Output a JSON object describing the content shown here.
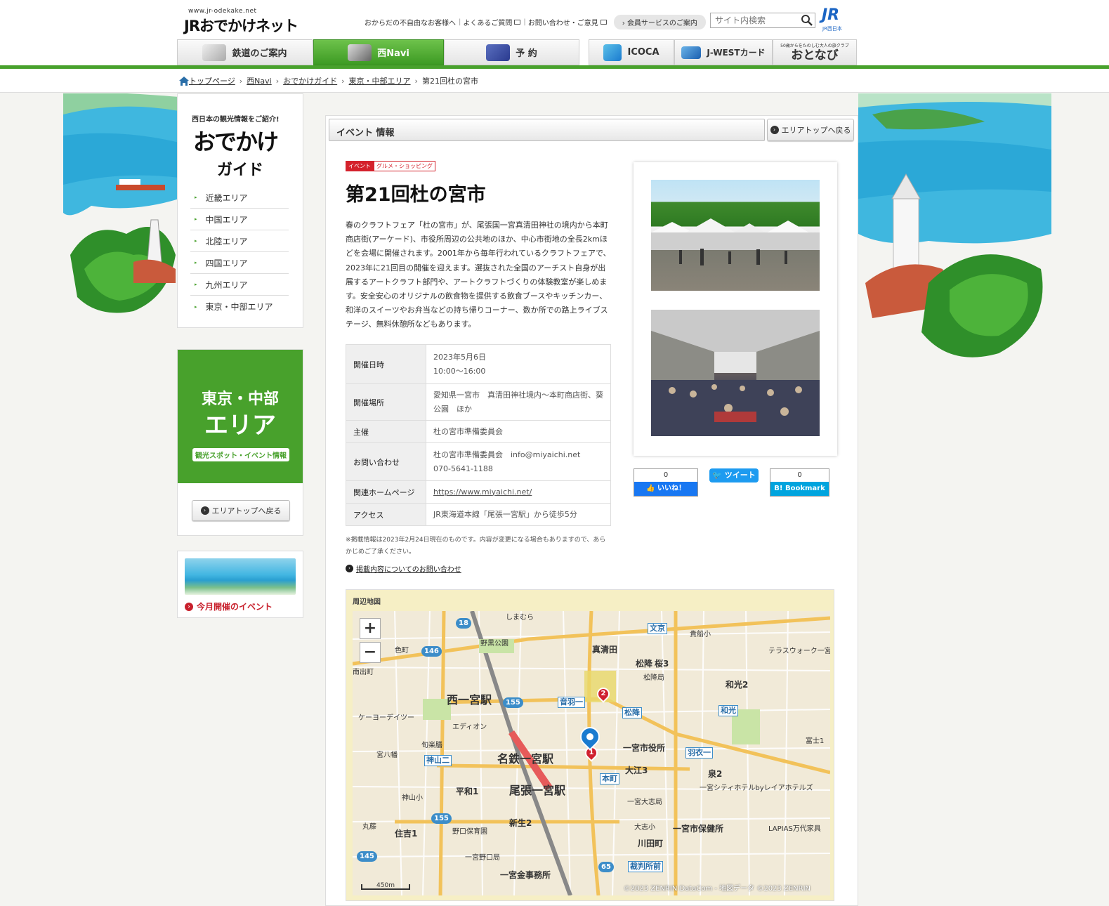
{
  "header": {
    "logo_url_text": "www.jr-odekake.net",
    "logo_text": "JRおでかけネット",
    "util_links": [
      "おからだの不自由なお客様へ",
      "よくあるご質問",
      "お問い合わせ・ご意見"
    ],
    "member_label": "会員サービスのご案内",
    "search_placeholder": "サイト内検索",
    "jr_logo": "JR",
    "jr_logo_sub": "JR西日本"
  },
  "nav": {
    "tabs": [
      {
        "label": "鉄道のご案内",
        "icon": "train-icon"
      },
      {
        "label": "西Navi",
        "icon": "camera-icon"
      },
      {
        "label": "予 約",
        "icon": "seat-icon"
      },
      {
        "label": "ICOCA",
        "icon": "icoca-icon"
      },
      {
        "label": "J-WESTカード",
        "icon": "card-icon"
      },
      {
        "label": "おとなび",
        "icon": "otonavi-logo",
        "sublabel": "50歳からをたのしむ大人の旅クラブ"
      }
    ]
  },
  "breadcrumb": [
    "トップページ",
    "西Navi",
    "おでかけガイド",
    "東京・中部エリア",
    "第21回杜の宮市"
  ],
  "sidebar": {
    "guide_tagline": "西日本の観光情報をご紹介!",
    "guide_title_line1": "おでかけ",
    "guide_title_line2": "ガイド",
    "areas": [
      "近畿エリア",
      "中国エリア",
      "北陸エリア",
      "四国エリア",
      "九州エリア",
      "東京・中部エリア"
    ],
    "area_banner_line1": "東京・中部",
    "area_banner_line2": "エリア",
    "area_banner_sub": "観光スポット・イベント情報",
    "area_top_button": "エリアトップへ戻る",
    "month_event_label": "今月開催のイベント"
  },
  "main": {
    "section_title": "イベント 情報",
    "area_top_button": "エリアトップへ戻る",
    "tags": [
      "イベント",
      "グルメ・ショッピング"
    ],
    "event_title": "第21回杜の宮市",
    "description": "春のクラフトフェア「杜の宮市」が、尾張国一宮真清田神社の境内から本町商店街(アーケード)、市役所周辺の公共地のほか、中心市街地の全長2kmほどを会場に開催されます。2001年から毎年行われているクラフトフェアで、2023年に21回目の開催を迎えます。選抜された全国のアーチスト自身が出展するアートクラフト部門や、アートクラフトづくりの体験教室が楽しめます。安全安心のオリジナルの飲食物を提供する飲食ブースやキッチンカー、和洋のスイーツやお弁当などの持ち帰りコーナー、数か所での路上ライブステージ、無料休憩所などもあります。",
    "info_rows": [
      {
        "label": "開催日時",
        "value": "2023年5月6日\n10:00～16:00"
      },
      {
        "label": "開催場所",
        "value": "愛知県一宮市　真清田神社境内～本町商店街、葵公園　ほか"
      },
      {
        "label": "主催",
        "value": "杜の宮市準備委員会"
      },
      {
        "label": "お問い合わせ",
        "value": "杜の宮市準備委員会　info@miyaichi.net　070-5641-1188"
      },
      {
        "label": "関連ホームページ",
        "value": "https://www.miyaichi.net/"
      },
      {
        "label": "アクセス",
        "value": "JR東海道本線「尾張一宮駅」から徒歩5分"
      }
    ],
    "note": "※掲載情報は2023年2月24日現在のものです。内容が変更になる場合もありますので、あらかじめご了承ください。",
    "inquiry_link": "掲載内容についてのお問い合わせ",
    "sns": {
      "fb_count": "0",
      "fb_label": "いいね！",
      "tw_label": "ツイート",
      "hb_count": "0",
      "hb_label": "Bookmark"
    },
    "map": {
      "label": "周辺地図",
      "zoom_in": "+",
      "zoom_out": "−",
      "scale": "450m",
      "copyright": "©2023 ZENRIN DataCom - 地図データ ©2023 ZENRIN",
      "places": [
        "西一宮駅",
        "名鉄一宮駅",
        "尾張一宮駅",
        "真清田",
        "松降",
        "和光2",
        "一宮市役所",
        "大江3",
        "泉2",
        "一宮市保健所",
        "平和1",
        "神山小",
        "新生2",
        "住吉1",
        "川田町",
        "一宮金事務所",
        "桜3",
        "松降局",
        "LAPIAS万代家具",
        "テラスウォーク一宮",
        "一宮シティホテルbyレイアホテルズ",
        "しまむら",
        "ケーヨーデイツー",
        "エディオン",
        "野黒公園",
        "貴船小",
        "富士1",
        "南出町",
        "色町",
        "一宮大志局",
        "大志小",
        "野口保育園",
        "一宮野口局",
        "丸藤",
        "宮八幡",
        "旬楽膳"
      ],
      "boxes": [
        "文京",
        "音羽一",
        "松降",
        "和光",
        "羽衣一",
        "本町",
        "神山二",
        "裁判所前"
      ],
      "routes": [
        "18",
        "146",
        "155",
        "155",
        "145",
        "65"
      ]
    }
  }
}
